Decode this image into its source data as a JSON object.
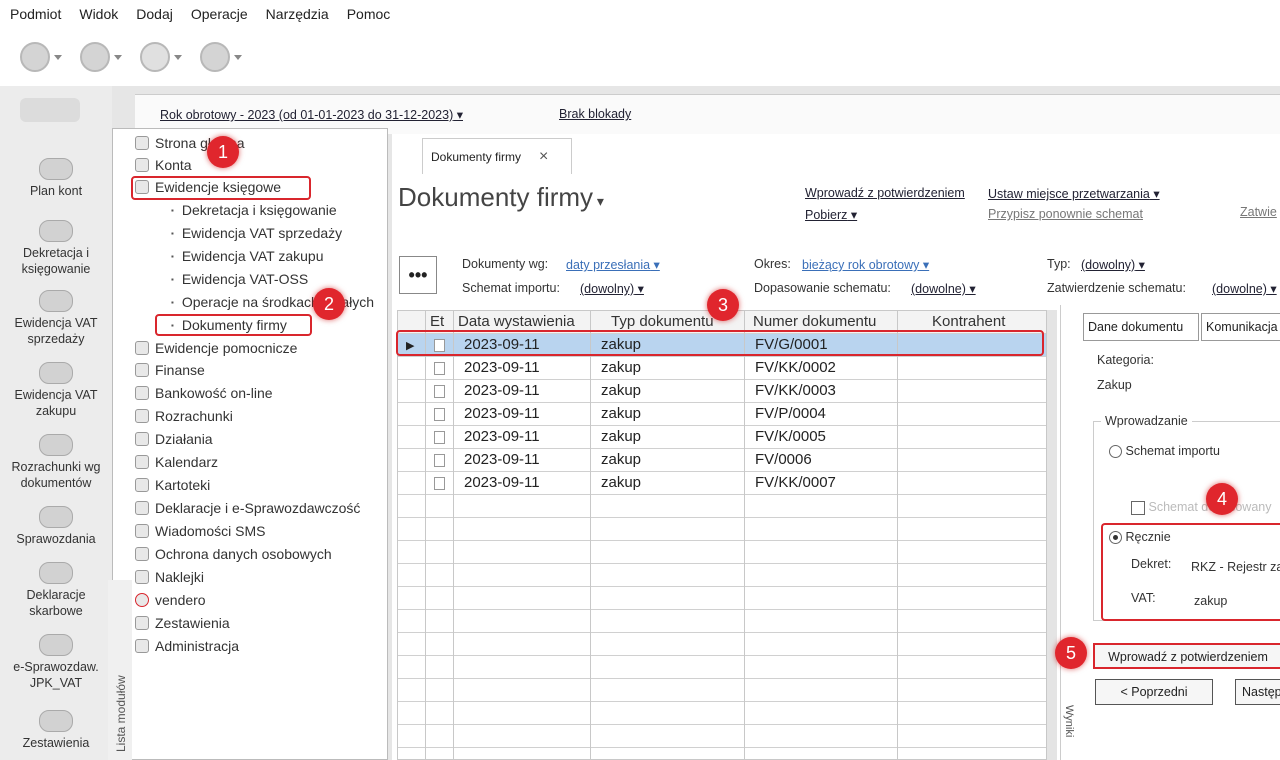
{
  "menubar": {
    "items": [
      "Podmiot",
      "Widok",
      "Dodaj",
      "Operacje",
      "Narzędzia",
      "Pomoc"
    ]
  },
  "toolbar": {
    "icons": [
      "envelope-icon",
      "globe-icon",
      "s-logo-icon",
      "help-icon"
    ]
  },
  "yearbar": {
    "year_label": "Rok obrotowy - 2023 (od 01-01-2023 do 31-12-2023)",
    "lock_label": "Brak blokady"
  },
  "leftbar": {
    "items": [
      "Plan kont",
      "Dekretacja i księgowanie",
      "Ewidencja VAT sprzedaży",
      "Ewidencja VAT zakupu",
      "Rozrachunki wg dokumentów",
      "Sprawozdania",
      "Deklaracje skarbowe",
      "e-Sprawozdaw. JPK_VAT",
      "Zestawienia"
    ]
  },
  "nav": {
    "items_top": [
      "Strona główna",
      "Konta",
      "Ewidencje księgowe"
    ],
    "subitems": [
      "Dekretacja i księgowanie",
      "Ewidencja VAT sprzedaży",
      "Ewidencja VAT zakupu",
      "Ewidencja VAT-OSS",
      "Operacje na środkach trwałych",
      "Dokumenty firmy"
    ],
    "items_bottom": [
      "Ewidencje pomocnicze",
      "Finanse",
      "Bankowość on-line",
      "Rozrachunki",
      "Działania",
      "Kalendarz",
      "Kartoteki",
      "Deklaracje i e-Sprawozdawczość",
      "Wiadomości SMS",
      "Ochrona danych osobowych",
      "Naklejki",
      "vendero",
      "Zestawienia",
      "Administracja"
    ],
    "vertical_label": "Lista modułów"
  },
  "badges": [
    "1",
    "2",
    "3",
    "4",
    "5"
  ],
  "tab": {
    "label": "Dokumenty firmy",
    "close": "×"
  },
  "page": {
    "title": "Dokumenty firmy"
  },
  "actions": {
    "enter_confirm": "Wprowadź z potwierdzeniem",
    "download": "Pobierz",
    "set_processing": "Ustaw miejsce przetwarzania",
    "assign_scheme": "Przypisz ponownie schemat",
    "cut_right": "Zatwie"
  },
  "filters": {
    "more": "•••",
    "docs_by_label": "Dokumenty wg:",
    "docs_by_value": "daty przesłania",
    "period_label": "Okres:",
    "period_value": "bieżący rok obrotowy",
    "type_label": "Typ:",
    "type_value": "(dowolny)",
    "import_label": "Schemat importu:",
    "import_value": "(dowolny)",
    "match_label": "Dopasowanie schematu:",
    "match_value": "(dowolne)",
    "approve_label": "Zatwierdzenie schematu:",
    "approve_value": "(dowolne)"
  },
  "grid": {
    "columns": [
      "Et",
      "Data wystawienia",
      "Typ dokumentu",
      "Numer dokumentu",
      "Kontrahent"
    ],
    "rows": [
      {
        "date": "2023-09-11",
        "type": "zakup",
        "number": "FV/G/0001",
        "contractor": ""
      },
      {
        "date": "2023-09-11",
        "type": "zakup",
        "number": "FV/KK/0002",
        "contractor": ""
      },
      {
        "date": "2023-09-11",
        "type": "zakup",
        "number": "FV/KK/0003",
        "contractor": ""
      },
      {
        "date": "2023-09-11",
        "type": "zakup",
        "number": "FV/P/0004",
        "contractor": ""
      },
      {
        "date": "2023-09-11",
        "type": "zakup",
        "number": "FV/K/0005",
        "contractor": ""
      },
      {
        "date": "2023-09-11",
        "type": "zakup",
        "number": "FV/0006",
        "contractor": ""
      },
      {
        "date": "2023-09-11",
        "type": "zakup",
        "number": "FV/KK/0007",
        "contractor": ""
      }
    ]
  },
  "side": {
    "tab1": "Dane dokumentu",
    "tab2": "Komunikacja",
    "category_label": "Kategoria:",
    "category_value": "Zakup",
    "group_label": "Wprowadzanie",
    "radio_import": "Schemat importu",
    "checkbox_label": "Schemat dopasowany",
    "radio_manual": "Ręcznie",
    "dekret_label": "Dekret:",
    "dekret_value": "RKZ - Rejestr zakupów",
    "vat_label": "VAT:",
    "vat_value": "zakup",
    "confirm_button": "Wprowadź z potwierdzeniem",
    "prev_button": "<   Poprzedni",
    "next_button": "Następny",
    "vertical_text": "Wyniki"
  },
  "colors": {
    "highlight": "#d9262d",
    "selection": "#b9d4ef",
    "link": "#3a6fb8"
  }
}
